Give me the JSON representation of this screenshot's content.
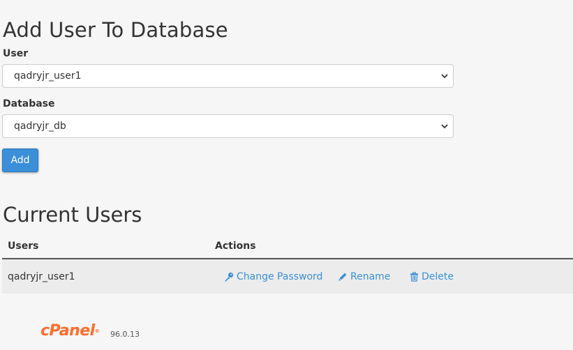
{
  "add_section": {
    "title": "Add User To Database",
    "user_label": "User",
    "user_selected": "qadryjr_user1",
    "database_label": "Database",
    "database_selected": "qadryjr_db",
    "add_button": "Add"
  },
  "current_users": {
    "title": "Current Users",
    "columns": [
      "Users",
      "Actions"
    ],
    "rows": [
      {
        "user": "qadryjr_user1",
        "actions": {
          "change_password": "Change Password",
          "rename": "Rename",
          "delete": "Delete"
        }
      }
    ]
  },
  "footer": {
    "logo_text": "cPanel",
    "version": "96.0.13"
  },
  "colors": {
    "accent": "#3a8fd8",
    "brand": "#ff6c2c"
  },
  "icons": [
    "chevron-down-icon",
    "key-icon",
    "pencil-icon",
    "trash-icon"
  ]
}
